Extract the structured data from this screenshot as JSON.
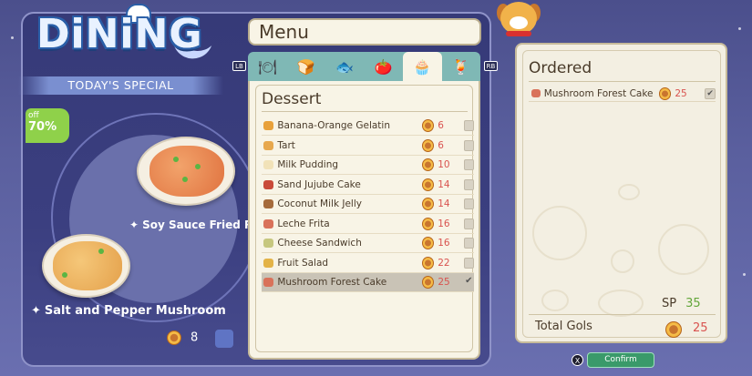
{
  "left": {
    "logo": "DiNiNG",
    "special_banner": "TODAY'S SPECIAL",
    "discount": {
      "off_label": "off",
      "percent": "70%"
    },
    "dishes": [
      {
        "name": "Soy Sauce Fried Rice"
      },
      {
        "name": "Salt and Pepper Mushroom"
      }
    ],
    "price": "8"
  },
  "menu": {
    "title": "Menu",
    "lb": "LB",
    "rb": "RB",
    "tabs": [
      {
        "icon": "cloche-icon",
        "glyph": "🍽"
      },
      {
        "icon": "bread-icon",
        "glyph": "🍞"
      },
      {
        "icon": "fish-icon",
        "glyph": "🐟"
      },
      {
        "icon": "vegetable-icon",
        "glyph": "🍅"
      },
      {
        "icon": "dessert-icon",
        "glyph": "🧁",
        "active": true
      },
      {
        "icon": "drink-icon",
        "glyph": "🍹"
      }
    ],
    "category": "Dessert",
    "items": [
      {
        "name": "Banana-Orange Gelatin",
        "price": "6",
        "color": "#e8a13b"
      },
      {
        "name": "Tart",
        "price": "6",
        "color": "#e7a84e"
      },
      {
        "name": "Milk Pudding",
        "price": "10",
        "color": "#f1e2b8"
      },
      {
        "name": "Sand Jujube Cake",
        "price": "14",
        "color": "#c94b3a"
      },
      {
        "name": "Coconut Milk Jelly",
        "price": "14",
        "color": "#a56b3c"
      },
      {
        "name": "Leche Frita",
        "price": "16",
        "color": "#d9725a"
      },
      {
        "name": "Cheese Sandwich",
        "price": "16",
        "color": "#c6c77f"
      },
      {
        "name": "Fruit Salad",
        "price": "22",
        "color": "#e3b347"
      },
      {
        "name": "Mushroom Forest Cake",
        "price": "25",
        "color": "#d9725a",
        "selected": true,
        "check": "✔"
      }
    ]
  },
  "ordered": {
    "title": "Ordered",
    "items": [
      {
        "name": "Mushroom Forest Cake",
        "price": "25",
        "check": "✔"
      }
    ],
    "sp_label": "SP",
    "sp_value": "35",
    "total_label": "Total Gols",
    "total_value": "25"
  },
  "footer": {
    "x_glyph": "X",
    "confirm_label": "Confirm"
  }
}
